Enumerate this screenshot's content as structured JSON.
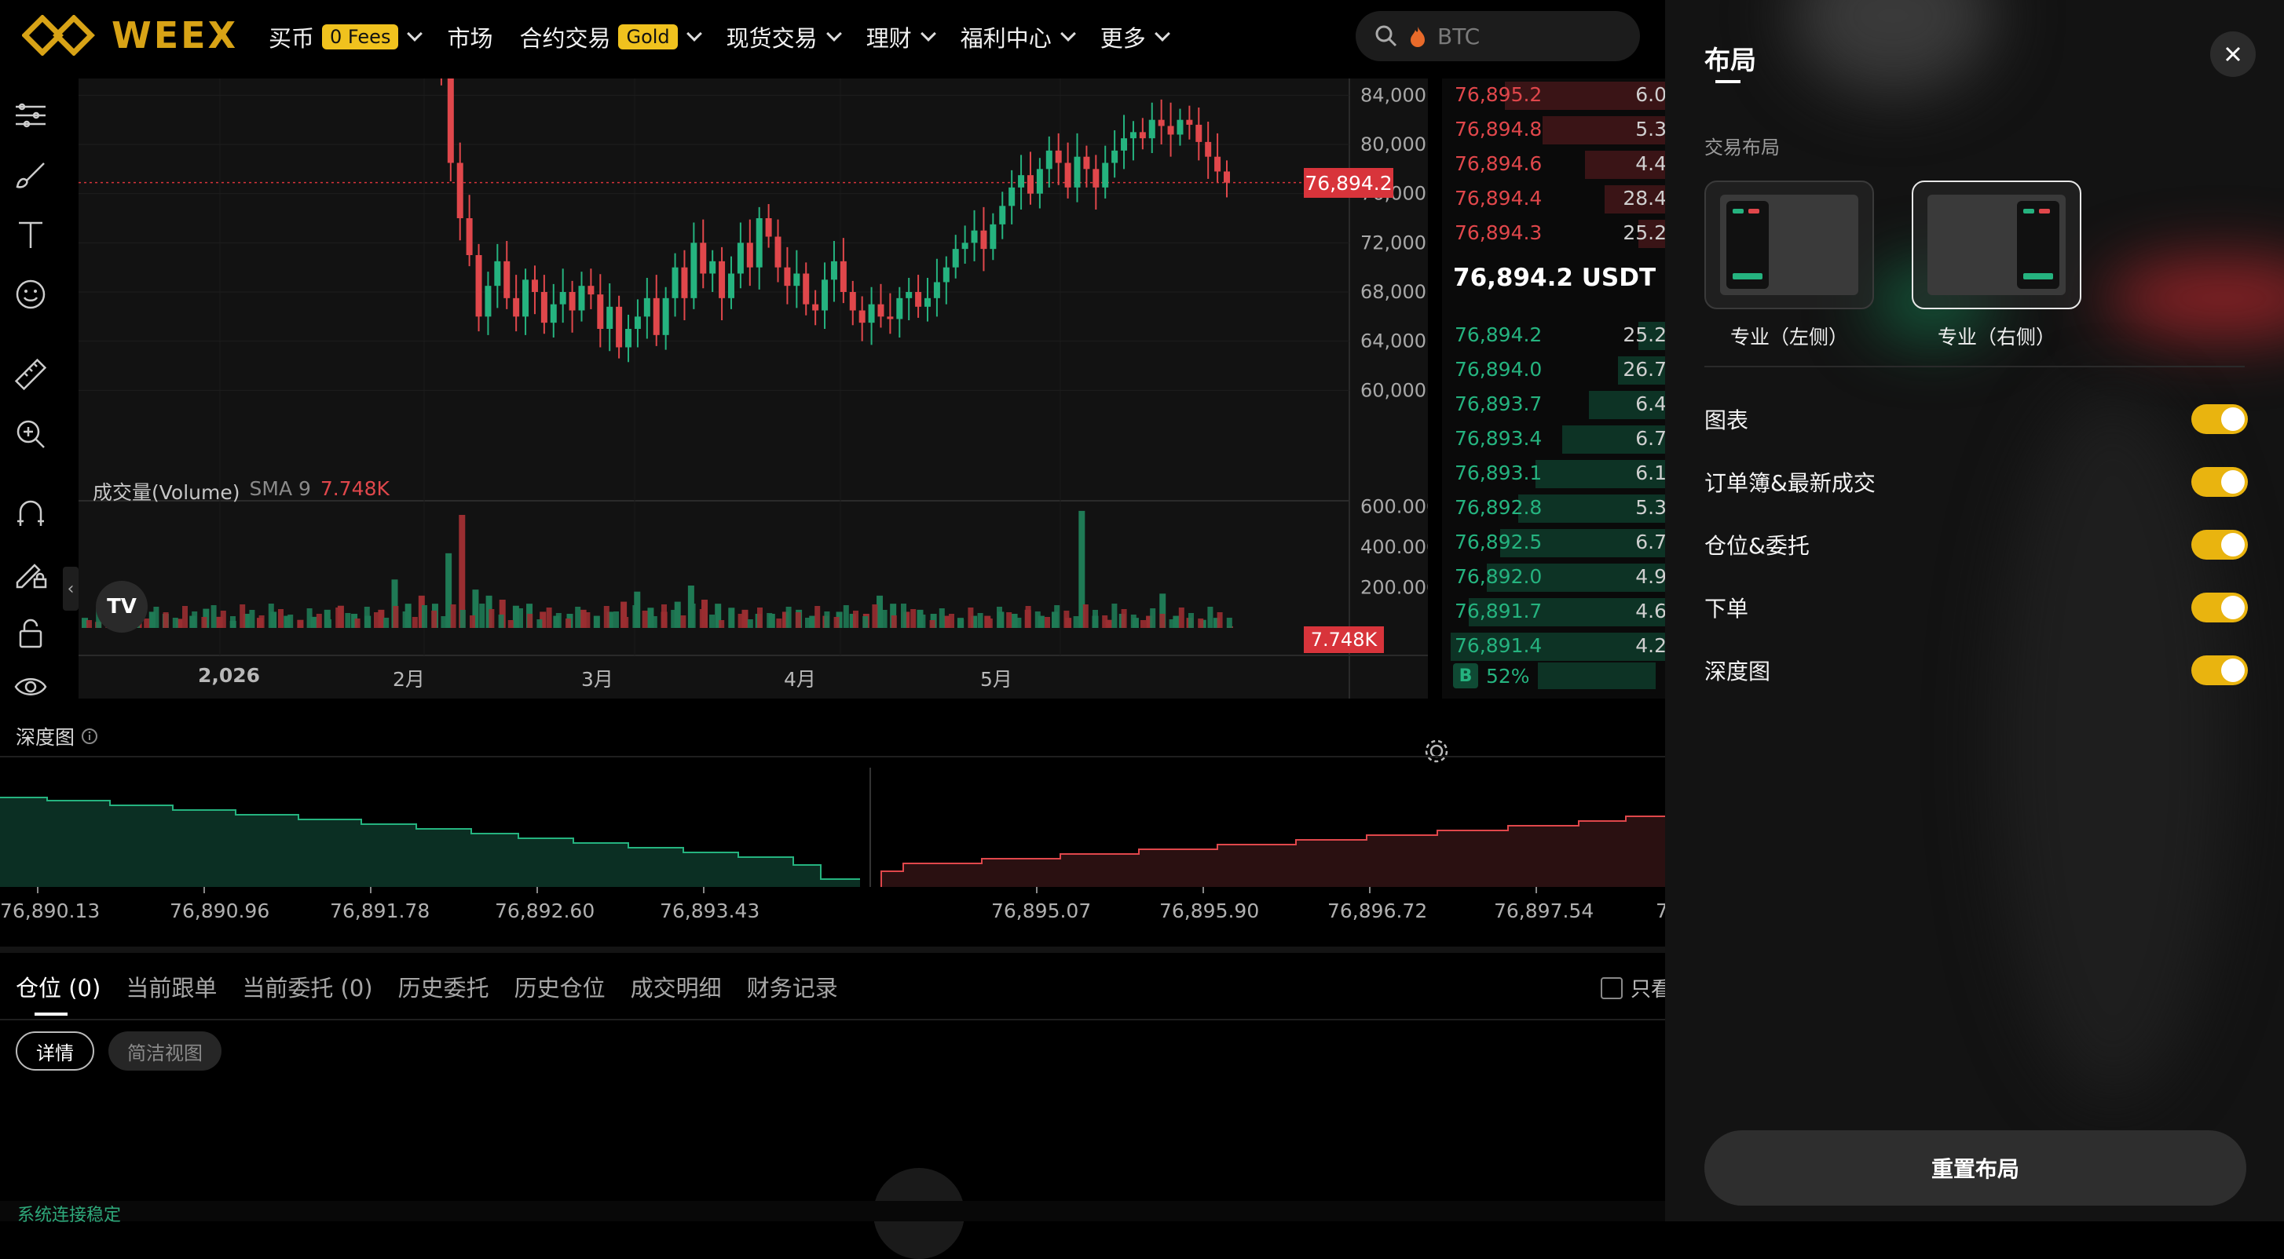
{
  "header": {
    "logo_text": "WEEX",
    "nav": [
      {
        "label": "买币",
        "badge": "0 Fees",
        "has_dropdown": true
      },
      {
        "label": "市场",
        "badge": null,
        "has_dropdown": false
      },
      {
        "label": "合约交易",
        "badge": "Gold",
        "has_dropdown": true
      },
      {
        "label": "现货交易",
        "badge": null,
        "has_dropdown": true
      },
      {
        "label": "理财",
        "badge": null,
        "has_dropdown": true
      },
      {
        "label": "福利中心",
        "badge": null,
        "has_dropdown": true
      },
      {
        "label": "更多",
        "badge": null,
        "has_dropdown": true
      }
    ],
    "search_placeholder": "BTC"
  },
  "toolbar": {
    "icons": [
      "trend-lines-icon",
      "brush-icon",
      "text-icon",
      "emoji-icon",
      "ruler-icon",
      "zoom-in-icon",
      "magnet-icon",
      "draw-lock-icon",
      "lock-icon",
      "eye-icon"
    ]
  },
  "chart": {
    "price_axis": [
      "84,000.0",
      "80,000.0",
      "76,000.0",
      "72,000.0",
      "68,000.0",
      "64,000.0",
      "60,000.0"
    ],
    "current_price_tag": "76,894.2",
    "volume_legend": {
      "name": "成交量(Volume)",
      "sma": "SMA 9",
      "value": "7.748K"
    },
    "volume_axis": [
      "600.000K",
      "400.000K",
      "200.000K"
    ],
    "volume_tag": "7.748K",
    "date_axis": [
      "2,026",
      "2月",
      "3月",
      "4月",
      "5月"
    ]
  },
  "chart_data": {
    "type": "candlestick",
    "title": "",
    "ylim": [
      56000,
      86000
    ],
    "y_ticks": [
      60000,
      64000,
      68000,
      72000,
      76000,
      80000,
      84000
    ],
    "current_price": 76894.2,
    "x_labels": [
      "2,026",
      "2月",
      "3月",
      "4月",
      "5月"
    ],
    "closes": [
      88500,
      86000,
      78500,
      74000,
      71000,
      66000,
      68500,
      70500,
      67500,
      66000,
      69000,
      68000,
      65500,
      67000,
      68000,
      66500,
      68500,
      67800,
      65000,
      66800,
      63500,
      65000,
      66000,
      67500,
      64500,
      67500,
      70000,
      67500,
      72000,
      69500,
      70500,
      67500,
      69500,
      72000,
      70000,
      74000,
      72500,
      70000,
      68500,
      69500,
      67000,
      66500,
      69000,
      70500,
      68000,
      66500,
      65500,
      67000,
      66000,
      65800,
      67500,
      68000,
      66800,
      67500,
      68800,
      70000,
      71500,
      72000,
      73000,
      71500,
      73500,
      75000,
      76500,
      77500,
      76000,
      78000,
      79500,
      78500,
      76500,
      79000,
      78000,
      76500,
      78500,
      79500,
      80500,
      81000,
      80500,
      82000,
      81500,
      80800,
      82000,
      81600,
      80200,
      79000,
      77800,
      76894
    ],
    "volume": {
      "label": "成交量(Volume)",
      "sma_period": 9,
      "last": "7.748K",
      "ylim": [
        0,
        700000
      ],
      "values": [
        50000,
        30000,
        90000,
        60000,
        40000,
        80000,
        70000,
        45000,
        60000,
        95000,
        55000,
        35000,
        70000,
        50000,
        80000,
        60000,
        40000,
        55000,
        90000,
        110000,
        70000,
        60000,
        90000,
        240000,
        120000,
        160000,
        120000,
        370000,
        560000,
        190000,
        160000,
        140000,
        110000,
        120000,
        80000,
        60000,
        70000,
        90000,
        60000,
        80000,
        130000,
        180000,
        100000,
        80000,
        130000,
        210000,
        140000,
        120000,
        100000,
        90000,
        70000,
        70000,
        80000,
        90000,
        60000,
        60000,
        80000,
        70000,
        70000,
        160000,
        120000,
        80000,
        90000,
        70000,
        60000,
        50000,
        60000,
        60000,
        80000,
        70000,
        90000,
        60000,
        80000,
        50000,
        580000,
        60000,
        40000,
        70000,
        50000,
        60000,
        170000,
        60000,
        50000,
        40000,
        50000,
        7748
      ],
      "ticks": [
        200000,
        400000,
        600000
      ]
    }
  },
  "orderbook": {
    "asks": [
      {
        "price": "76,895.2",
        "qty": "6.0",
        "depth": 0.72
      },
      {
        "price": "76,894.8",
        "qty": "5.3",
        "depth": 0.55
      },
      {
        "price": "76,894.6",
        "qty": "4.4",
        "depth": 0.36
      },
      {
        "price": "76,894.4",
        "qty": "28.4",
        "depth": 0.27
      },
      {
        "price": "76,894.3",
        "qty": "25.2",
        "depth": 0.12
      }
    ],
    "last_price": "76,894.2 USDT",
    "bids": [
      {
        "price": "76,894.2",
        "qty": "25.2",
        "depth": 0.12
      },
      {
        "price": "76,894.0",
        "qty": "26.7",
        "depth": 0.21
      },
      {
        "price": "76,893.7",
        "qty": "6.4",
        "depth": 0.34
      },
      {
        "price": "76,893.4",
        "qty": "6.7",
        "depth": 0.46
      },
      {
        "price": "76,893.1",
        "qty": "6.1",
        "depth": 0.58
      },
      {
        "price": "76,892.8",
        "qty": "5.3",
        "depth": 0.66
      },
      {
        "price": "76,892.5",
        "qty": "6.7",
        "depth": 0.74
      },
      {
        "price": "76,892.0",
        "qty": "4.9",
        "depth": 0.8
      },
      {
        "price": "76,891.7",
        "qty": "4.6",
        "depth": 0.88
      },
      {
        "price": "76,891.4",
        "qty": "4.2",
        "depth": 0.96
      }
    ],
    "buy_label": "B",
    "buy_ratio": "52%"
  },
  "depth": {
    "title": "深度图",
    "ticks": [
      "76,890.13",
      "76,890.96",
      "76,891.78",
      "76,892.60",
      "76,893.43",
      "76,895.07",
      "76,895.90",
      "76,896.72",
      "76,897.54",
      "7"
    ]
  },
  "positions": {
    "tabs": [
      "仓位 (0)",
      "当前跟单",
      "当前委托 (0)",
      "历史委托",
      "历史仓位",
      "成交明细",
      "财务记录"
    ],
    "only_show": "只看",
    "views": [
      "详情",
      "简洁视图"
    ],
    "status": "系统连接稳定"
  },
  "drawer": {
    "title": "布局",
    "section_label": "交易布局",
    "layout_options": [
      {
        "label": "专业（左侧）",
        "selected": false
      },
      {
        "label": "专业（右侧）",
        "selected": true
      }
    ],
    "toggles": [
      {
        "label": "图表",
        "on": true
      },
      {
        "label": "订单簿&最新成交",
        "on": true
      },
      {
        "label": "仓位&委托",
        "on": true
      },
      {
        "label": "下单",
        "on": true
      },
      {
        "label": "深度图",
        "on": true
      }
    ],
    "reset_label": "重置布局"
  },
  "colors": {
    "up": "#25b37f",
    "down": "#e0474b",
    "accent": "#e9b40f",
    "brand": "#d8a316"
  }
}
